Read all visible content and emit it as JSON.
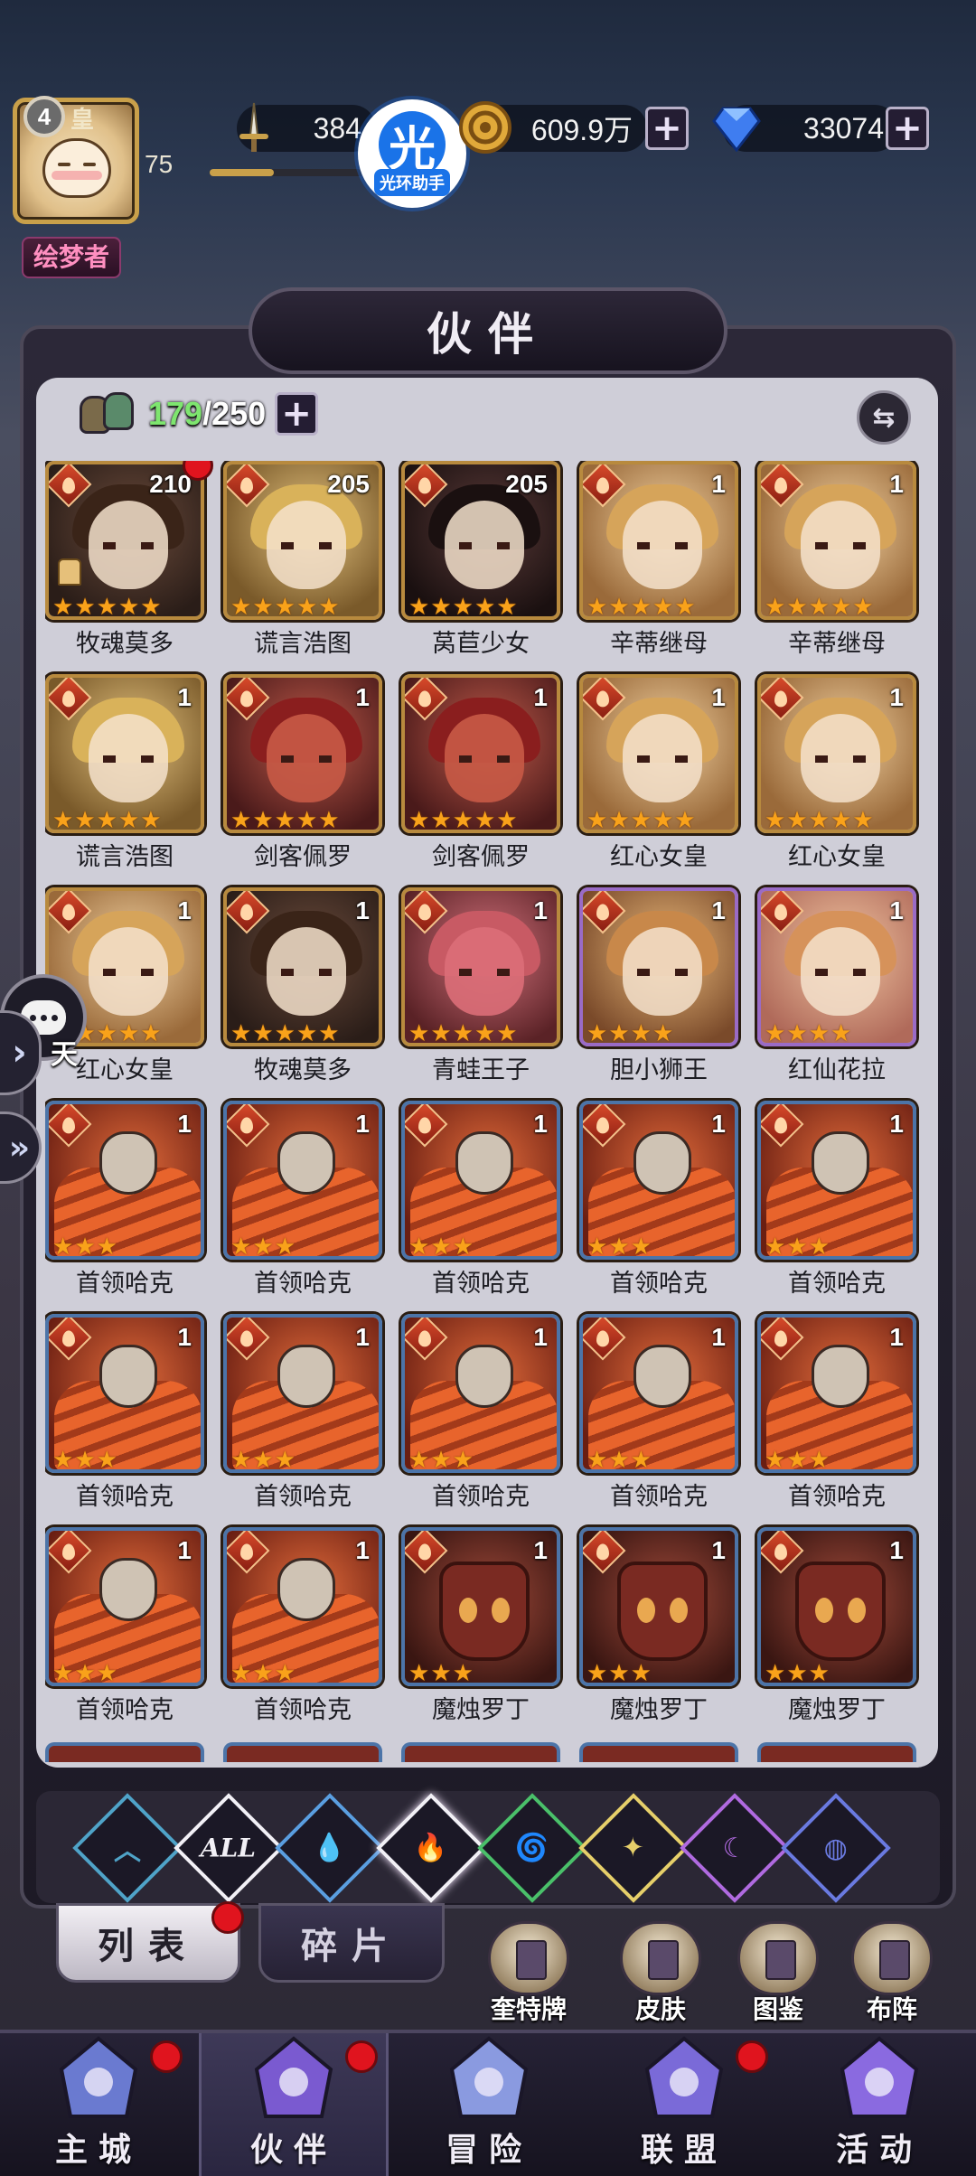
{
  "player": {
    "level_badge": "4",
    "avatar_suffix": "皇",
    "level": "75",
    "xp_fraction": 0.42,
    "title": "绘梦者"
  },
  "resources": {
    "power": "384",
    "gold": "609.9万",
    "diamonds": "33074",
    "plus": "+"
  },
  "helper": {
    "glyph": "光",
    "text": "光环助手"
  },
  "panel": {
    "title": "伙伴"
  },
  "roster": {
    "current": "179",
    "max": "/250",
    "plus": "+",
    "swap": "⇆"
  },
  "heroes": [
    {
      "name": "牧魂莫多",
      "level": "210",
      "stars": 5,
      "red_dot": true,
      "rank_icon": true,
      "art": "brown"
    },
    {
      "name": "谎言浩图",
      "level": "205",
      "stars": 5,
      "red_dot": false,
      "rank_icon": false,
      "art": "blond"
    },
    {
      "name": "莴苣少女",
      "level": "205",
      "stars": 5,
      "red_dot": false,
      "rank_icon": false,
      "art": "dark"
    },
    {
      "name": "辛蒂继母",
      "level": "1",
      "stars": 5,
      "red_dot": false,
      "rank_icon": false,
      "art": "queen"
    },
    {
      "name": "辛蒂继母",
      "level": "1",
      "stars": 5,
      "red_dot": false,
      "rank_icon": false,
      "art": "queen"
    },
    {
      "name": "谎言浩图",
      "level": "1",
      "stars": 5,
      "red_dot": false,
      "rank_icon": false,
      "art": "blond"
    },
    {
      "name": "剑客佩罗",
      "level": "1",
      "stars": 5,
      "red_dot": false,
      "rank_icon": false,
      "art": "fox"
    },
    {
      "name": "剑客佩罗",
      "level": "1",
      "stars": 5,
      "red_dot": false,
      "rank_icon": false,
      "art": "fox"
    },
    {
      "name": "红心女皇",
      "level": "1",
      "stars": 5,
      "red_dot": false,
      "rank_icon": false,
      "art": "queen"
    },
    {
      "name": "红心女皇",
      "level": "1",
      "stars": 5,
      "red_dot": false,
      "rank_icon": false,
      "art": "queen"
    },
    {
      "name": "红心女皇",
      "level": "1",
      "stars": 5,
      "red_dot": false,
      "rank_icon": false,
      "art": "queen"
    },
    {
      "name": "牧魂莫多",
      "level": "1",
      "stars": 5,
      "red_dot": false,
      "rank_icon": false,
      "art": "brown"
    },
    {
      "name": "青蛙王子",
      "level": "1",
      "stars": 5,
      "red_dot": false,
      "rank_icon": false,
      "art": "frog"
    },
    {
      "name": "胆小狮王",
      "level": "1",
      "stars": 4,
      "red_dot": false,
      "rank_icon": false,
      "art": "lion",
      "frame": "purple"
    },
    {
      "name": "红仙花拉",
      "level": "1",
      "stars": 4,
      "red_dot": false,
      "rank_icon": false,
      "art": "fairy",
      "frame": "purple"
    },
    {
      "name": "首领哈克",
      "level": "1",
      "stars": 3,
      "red_dot": false,
      "rank_icon": false,
      "art": "hawk",
      "frame": "blue"
    },
    {
      "name": "首领哈克",
      "level": "1",
      "stars": 3,
      "red_dot": false,
      "rank_icon": false,
      "art": "hawk",
      "frame": "blue"
    },
    {
      "name": "首领哈克",
      "level": "1",
      "stars": 3,
      "red_dot": false,
      "rank_icon": false,
      "art": "hawk",
      "frame": "blue"
    },
    {
      "name": "首领哈克",
      "level": "1",
      "stars": 3,
      "red_dot": false,
      "rank_icon": false,
      "art": "hawk",
      "frame": "blue"
    },
    {
      "name": "首领哈克",
      "level": "1",
      "stars": 3,
      "red_dot": false,
      "rank_icon": false,
      "art": "hawk",
      "frame": "blue"
    },
    {
      "name": "首领哈克",
      "level": "1",
      "stars": 3,
      "red_dot": false,
      "rank_icon": false,
      "art": "hawk",
      "frame": "blue"
    },
    {
      "name": "首领哈克",
      "level": "1",
      "stars": 3,
      "red_dot": false,
      "rank_icon": false,
      "art": "hawk",
      "frame": "blue"
    },
    {
      "name": "首领哈克",
      "level": "1",
      "stars": 3,
      "red_dot": false,
      "rank_icon": false,
      "art": "hawk",
      "frame": "blue"
    },
    {
      "name": "首领哈克",
      "level": "1",
      "stars": 3,
      "red_dot": false,
      "rank_icon": false,
      "art": "hawk",
      "frame": "blue"
    },
    {
      "name": "首领哈克",
      "level": "1",
      "stars": 3,
      "red_dot": false,
      "rank_icon": false,
      "art": "hawk",
      "frame": "blue"
    },
    {
      "name": "首领哈克",
      "level": "1",
      "stars": 3,
      "red_dot": false,
      "rank_icon": false,
      "art": "hawk",
      "frame": "blue"
    },
    {
      "name": "首领哈克",
      "level": "1",
      "stars": 3,
      "red_dot": false,
      "rank_icon": false,
      "art": "hawk",
      "frame": "blue"
    },
    {
      "name": "魔烛罗丁",
      "level": "1",
      "stars": 3,
      "red_dot": false,
      "rank_icon": false,
      "art": "candle",
      "frame": "blue"
    },
    {
      "name": "魔烛罗丁",
      "level": "1",
      "stars": 3,
      "red_dot": false,
      "rank_icon": false,
      "art": "candle",
      "frame": "blue"
    },
    {
      "name": "魔烛罗丁",
      "level": "1",
      "stars": 3,
      "red_dot": false,
      "rank_icon": false,
      "art": "candle",
      "frame": "blue"
    }
  ],
  "element_filters": [
    {
      "icon": "aqua-chevron-icon",
      "glyph": "︿",
      "color": "#4fa3c8"
    },
    {
      "icon": "all-icon",
      "glyph": "ALL",
      "color": "#f2f0f6"
    },
    {
      "icon": "water-drop-icon",
      "glyph": "💧",
      "color": "#5a9ee0"
    },
    {
      "icon": "fire-icon",
      "glyph": "🔥",
      "color": "#e0462a",
      "active": true
    },
    {
      "icon": "wind-icon",
      "glyph": "🌀",
      "color": "#4ac06a"
    },
    {
      "icon": "light-icon",
      "glyph": "✦",
      "color": "#e6cf6a"
    },
    {
      "icon": "moon-icon",
      "glyph": "☾",
      "color": "#b06ae0"
    },
    {
      "icon": "planet-icon",
      "glyph": "◍",
      "color": "#6a7ae0"
    }
  ],
  "subtabs": {
    "list": "列表",
    "fragments": "碎片"
  },
  "shortcuts": [
    {
      "label": "奎特牌",
      "icon": "tarot-card-icon"
    },
    {
      "label": "皮肤",
      "icon": "skin-icon"
    },
    {
      "label": "图鉴",
      "icon": "codex-icon"
    },
    {
      "label": "布阵",
      "icon": "formation-icon"
    }
  ],
  "nav": [
    {
      "label": "主城",
      "icon": "castle-icon",
      "dot": true
    },
    {
      "label": "伙伴",
      "icon": "wizard-hat-icon",
      "dot": true,
      "active": true
    },
    {
      "label": "冒险",
      "icon": "compass-icon",
      "dot": false
    },
    {
      "label": "联盟",
      "icon": "shield-icon",
      "dot": true
    },
    {
      "label": "活动",
      "icon": "cards-icon",
      "dot": false
    }
  ],
  "side": {
    "label": "天",
    "expand": "»"
  }
}
